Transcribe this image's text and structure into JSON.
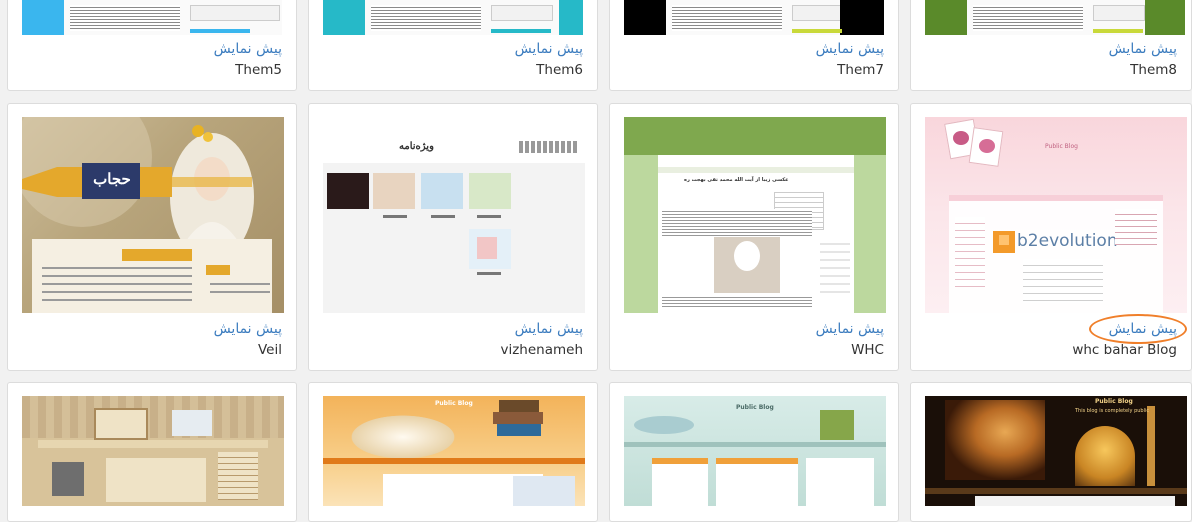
{
  "preview_label": "پیش نمایش",
  "rows": [
    [
      {
        "name": "Them5"
      },
      {
        "name": "Them6"
      },
      {
        "name": "Them7"
      },
      {
        "name": "Them8"
      }
    ],
    [
      {
        "name": "Veil"
      },
      {
        "name": "vizhenameh"
      },
      {
        "name": "WHC"
      },
      {
        "name": "whc bahar Blog"
      }
    ],
    [
      {
        "name": ""
      },
      {
        "name": ""
      },
      {
        "name": ""
      },
      {
        "name": ""
      }
    ]
  ],
  "thumb_text": {
    "hijab_banner": "حجاب",
    "vizhenameh_title": "ویژه‌نامه",
    "whc_headline": "عکسی زیبا از آیت الله محمد تقی بهجت ره",
    "b2evolution_logo": "b2evolution",
    "public_blog": "Public Blog",
    "public_blog_tagline": "This blog is completely public"
  },
  "colors": {
    "link": "#3d7dbf",
    "highlight_circle": "#f07f2a",
    "them5_accent": "#3ab6ee",
    "them6_accent": "#26b9c8",
    "them7_accent": "#000000",
    "them8_accent": "#5a8a2a"
  }
}
